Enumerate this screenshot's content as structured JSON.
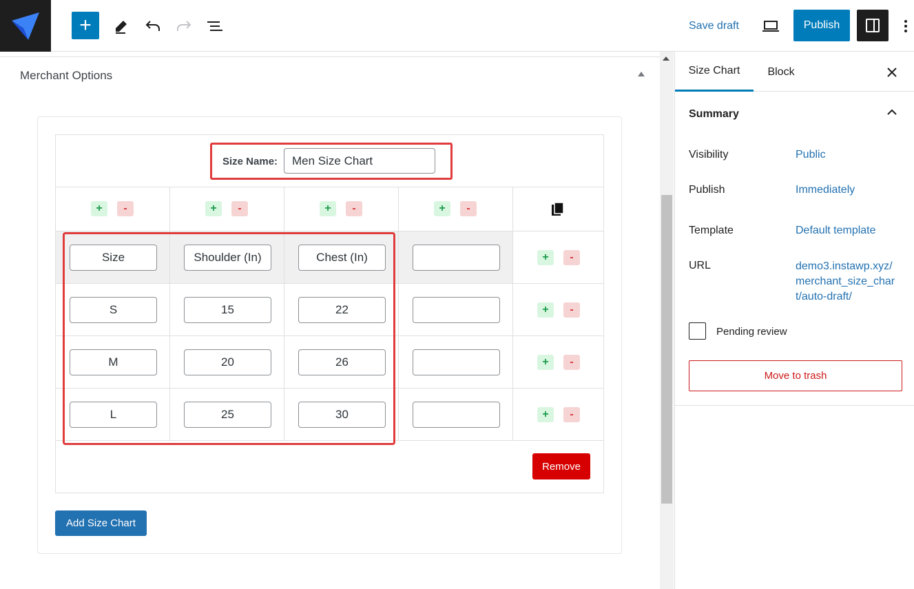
{
  "toolbar": {
    "add_icon": "+",
    "save_draft": "Save draft",
    "publish": "Publish"
  },
  "editor": {
    "section_title": "Merchant Options",
    "size_name_label": "Size Name:",
    "size_name_value": "Men Size Chart",
    "rows": [
      [
        "Size",
        "Shoulder (In)",
        "Chest (In)",
        ""
      ],
      [
        "S",
        "15",
        "22",
        ""
      ],
      [
        "M",
        "20",
        "26",
        ""
      ],
      [
        "L",
        "25",
        "30",
        ""
      ]
    ],
    "plus": "+",
    "minus": "-",
    "remove": "Remove",
    "add_size_chart": "Add Size Chart"
  },
  "sidebar": {
    "tab_size_chart": "Size Chart",
    "tab_block": "Block",
    "summary": "Summary",
    "visibility_label": "Visibility",
    "visibility_value": "Public",
    "publish_label": "Publish",
    "publish_value": "Immediately",
    "template_label": "Template",
    "template_value": "Default template",
    "url_label": "URL",
    "url_value": "demo3.instawp.xyz/merchant_size_chart/auto-draft/",
    "pending_review": "Pending review",
    "move_to_trash": "Move to trash"
  },
  "colors": {
    "accent": "#007cba",
    "highlight": "#e03c3c",
    "danger": "#d60000"
  }
}
